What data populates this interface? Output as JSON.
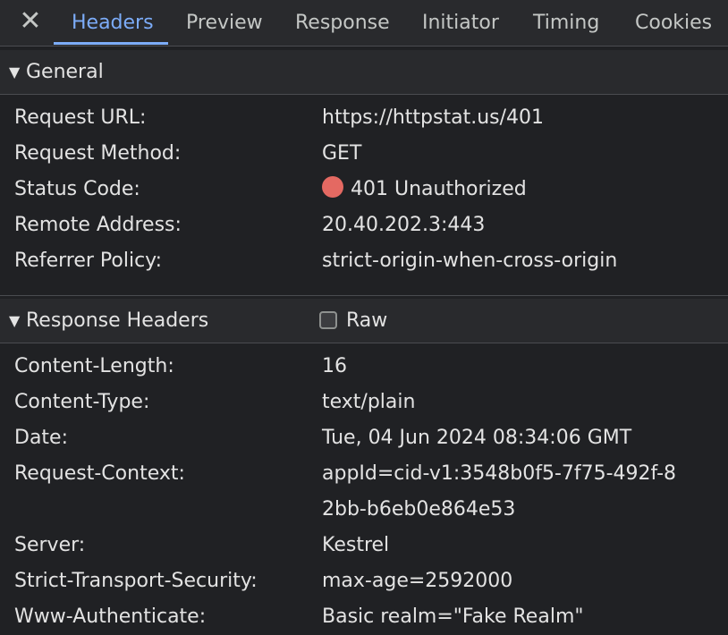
{
  "tabs": {
    "close_glyph": "✕",
    "items": [
      "Headers",
      "Preview",
      "Response",
      "Initiator",
      "Timing",
      "Cookies"
    ],
    "active": "Headers"
  },
  "general": {
    "toggle_glyph": "▼",
    "title": "General",
    "rows": [
      {
        "key": "Request URL:",
        "value": "https://httpstat.us/401"
      },
      {
        "key": "Request Method:",
        "value": "GET"
      },
      {
        "key": "Status Code:",
        "value": "401 Unauthorized"
      },
      {
        "key": "Remote Address:",
        "value": "20.40.202.3:443"
      },
      {
        "key": "Referrer Policy:",
        "value": "strict-origin-when-cross-origin"
      }
    ],
    "status_color": "#e46962"
  },
  "response_headers": {
    "toggle_glyph": "▼",
    "title": "Response Headers",
    "raw_label": "Raw",
    "raw_checked": false,
    "rows": [
      {
        "key": "Content-Length:",
        "value": "16"
      },
      {
        "key": "Content-Type:",
        "value": "text/plain"
      },
      {
        "key": "Date:",
        "value": "Tue, 04 Jun 2024 08:34:06 GMT"
      },
      {
        "key": "Request-Context:",
        "value": "appId=cid-v1:3548b0f5-7f75-492f-82bb-b6eb0e864e53"
      },
      {
        "key": "Server:",
        "value": "Kestrel"
      },
      {
        "key": "Strict-Transport-Security:",
        "value": "max-age=2592000"
      },
      {
        "key": "Www-Authenticate:",
        "value": "Basic realm=\"Fake Realm\""
      }
    ]
  }
}
